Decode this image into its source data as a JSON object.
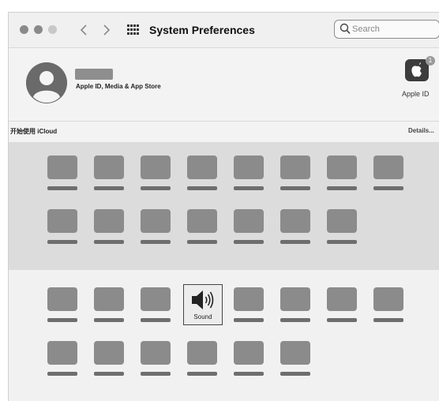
{
  "window": {
    "title": "System Preferences"
  },
  "toolbar": {
    "back_icon": "chevron-left",
    "forward_icon": "chevron-right",
    "grid_icon": "show-all-grid",
    "search": {
      "placeholder": "Search",
      "value": ""
    }
  },
  "account": {
    "subtitle": "Apple ID, Media & App Store",
    "apple_id_label": "Apple ID",
    "badge_count": "1"
  },
  "icloud": {
    "text": "开始使用 iCloud",
    "details_label": "Details..."
  },
  "sections": [
    {
      "rows": [
        8,
        7
      ]
    },
    {
      "rows": [
        8,
        6
      ]
    }
  ],
  "highlighted_pane": {
    "label": "Sound",
    "icon": "speaker-icon"
  },
  "colors": {
    "tile_icon": "#8b8b8b",
    "tile_label": "#6e6e6e",
    "section1_bg": "#dcdcdc",
    "section2_bg": "#f1f1f1"
  }
}
